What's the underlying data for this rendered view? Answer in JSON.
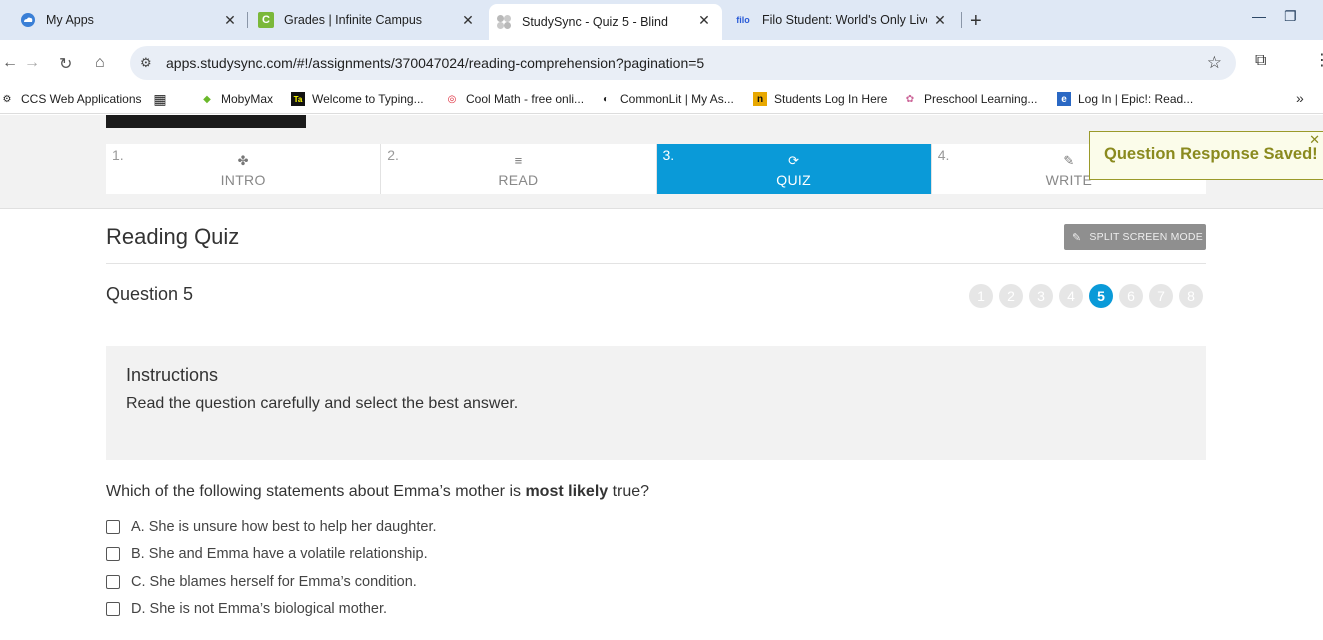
{
  "browser": {
    "tabs": [
      {
        "title": "My Apps",
        "icon": "cloud-icon",
        "active": false
      },
      {
        "title": "Grades | Infinite Campus",
        "icon": "infinite-campus-icon",
        "active": false
      },
      {
        "title": "StudySync - Quiz 5 - Blind",
        "icon": "studysync-icon",
        "active": true
      },
      {
        "title": "Filo Student: World's Only Live",
        "icon": "filo-icon",
        "active": false
      }
    ],
    "url": "apps.studysync.com/#!/assignments/370047024/reading-comprehension?pagination=5",
    "bookmarks": [
      "CCS Web Applications",
      "MobyMax",
      "Welcome to Typing...",
      "Cool Math - free onli...",
      "CommonLit | My As...",
      "Students Log In Here",
      "Preschool Learning...",
      "Log In | Epic!: Read..."
    ]
  },
  "steps": [
    {
      "num": "1.",
      "label": "INTRO",
      "icon": "fan-icon"
    },
    {
      "num": "2.",
      "label": "READ",
      "icon": "lines-icon"
    },
    {
      "num": "3.",
      "label": "QUIZ",
      "icon": "refresh-icon"
    },
    {
      "num": "4.",
      "label": "WRITE",
      "icon": "pencil-icon"
    }
  ],
  "toast": "Question Response Saved!",
  "quiz": {
    "title": "Reading Quiz",
    "split_label": "SPLIT SCREEN MODE",
    "question_label": "Question 5",
    "pages": [
      "1",
      "2",
      "3",
      "4",
      "5",
      "6",
      "7",
      "8"
    ],
    "current_page": "5",
    "instructions_title": "Instructions",
    "instructions_text": "Read the question carefully and select the best answer.",
    "question_pre": "Which of the following statements about Emma’s mother is ",
    "question_bold": "most likely",
    "question_post": " true?",
    "choices": [
      "A. She is unsure how best to help her daughter.",
      "B. She and Emma have a volatile relationship.",
      "C. She blames herself for Emma’s condition.",
      "D. She is not Emma’s biological mother."
    ]
  },
  "colors": {
    "accent": "#0a9ad8",
    "toast_text": "#8a8a1e"
  }
}
